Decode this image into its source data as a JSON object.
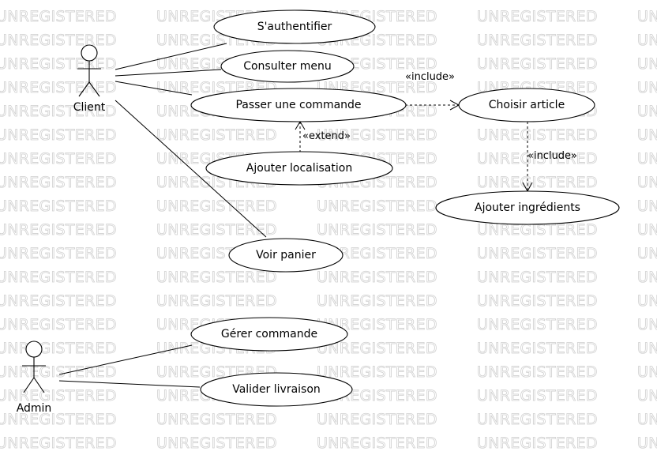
{
  "watermark": "UNREGISTERED",
  "actors": {
    "client": "Client",
    "admin": "Admin"
  },
  "use_cases": {
    "authentifier": "S'authentifier",
    "consulter_menu": "Consulter menu",
    "passer_commande": "Passer une commande",
    "choisir_article": "Choisir article",
    "ajouter_localisation": "Ajouter localisation",
    "ajouter_ingredients": "Ajouter ingrédients",
    "voir_panier": "Voir panier",
    "gerer_commande": "Gérer commande",
    "valider_livraison": "Valider livraison"
  },
  "stereotypes": {
    "include_1": "«include»",
    "extend": "«extend»",
    "include_2": "«include»"
  }
}
